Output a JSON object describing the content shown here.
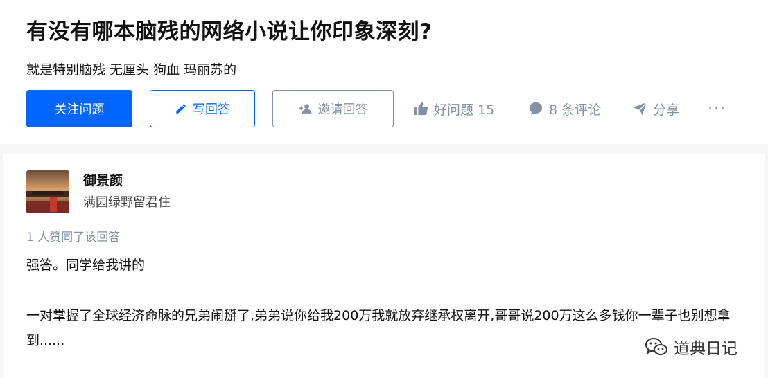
{
  "question": {
    "title": "有没有哪本脑残的网络小说让你印象深刻?",
    "description": "就是特别脑残 无厘头 狗血 玛丽苏的"
  },
  "actions": {
    "follow_label": "关注问题",
    "write_label": "写回答",
    "invite_label": "邀请回答",
    "good_question_label": "好问题 15",
    "comments_label": "8 条评论",
    "share_label": "分享",
    "more_label": "···"
  },
  "answer": {
    "author_name": "御景颜",
    "author_bio": "满园绿野留君住",
    "votes_text": "1 人赞同了该回答",
    "paragraphs": [
      "强答。同学给我讲的",
      "一对掌握了全球经济命脉的兄弟闹掰了,弟弟说你给我200万我就放弃继承权离开,哥哥说200万这么多钱你一辈子也别想拿到......"
    ]
  },
  "watermark": {
    "text": "道典日记"
  },
  "colors": {
    "brand": "#0066ff",
    "muted": "#8590a6",
    "text": "#121212"
  },
  "icons": [
    "pencil-icon",
    "invite-user-icon",
    "thumb-up-icon",
    "comment-icon",
    "share-arrow-icon",
    "more-icon",
    "wechat-logo-icon"
  ]
}
